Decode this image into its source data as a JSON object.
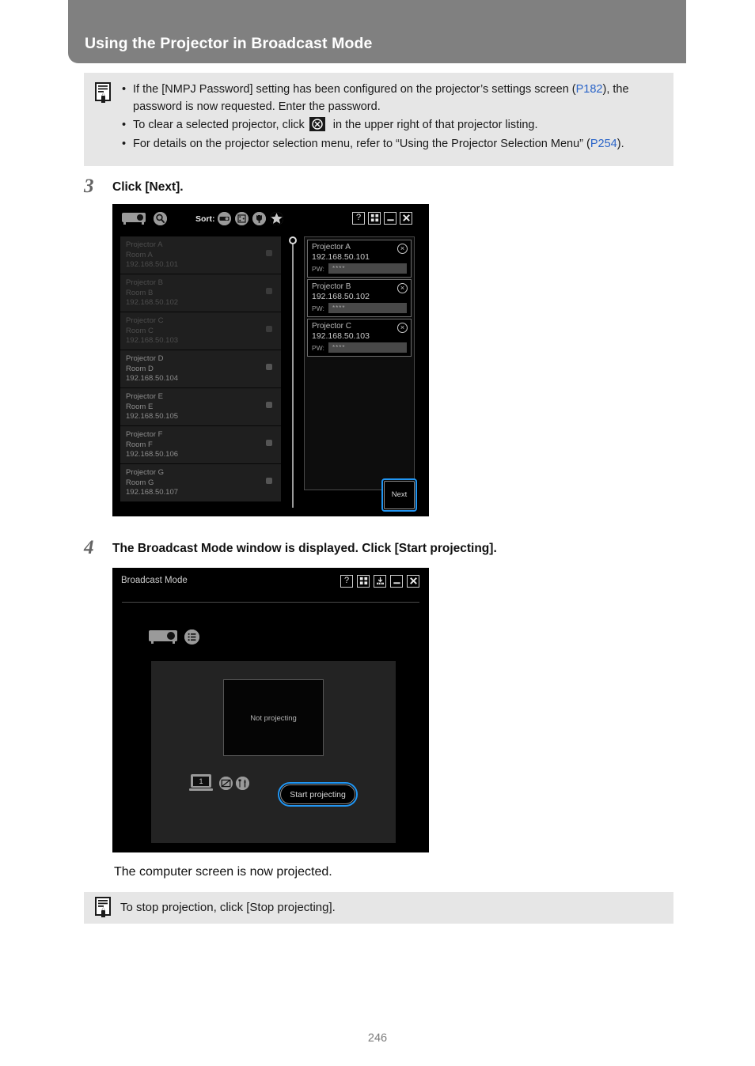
{
  "header": {
    "title": "Using the Projector in Broadcast Mode"
  },
  "note_top": {
    "icon": "note-document-pen-icon",
    "items": [
      {
        "bullet": "•",
        "part1": "If the [NMPJ Password] setting has been configured on the projector’s settings screen (",
        "ref": "P182",
        "part2": "), the password is now requested. Enter the password."
      },
      {
        "bullet": "•",
        "part1": "To clear a selected projector, click",
        "ref": "",
        "part2": "in the upper right of that projector listing."
      },
      {
        "bullet": "•",
        "part1": "For details on the projector selection menu, refer to “Using the Projector Selection Menu” (",
        "ref": "P254",
        "part2": ")."
      }
    ]
  },
  "step3": {
    "number": "3",
    "text": "Click [Next]."
  },
  "step4": {
    "number": "4",
    "text": "The Broadcast Mode window is displayed. Click [Start projecting]."
  },
  "shot1": {
    "toolbar": {
      "projector_icon": "projector-icon",
      "search_icon": "search-icon",
      "sort_label": "Sort:",
      "sort_icons": [
        "sort-by-projector-icon",
        "sort-by-grid-icon",
        "sort-by-power-icon",
        "sort-by-favorite-icon"
      ],
      "window_buttons": [
        {
          "name": "help-button",
          "glyph": "?"
        },
        {
          "name": "grid-layout-button",
          "glyph": "grid"
        },
        {
          "name": "minimize-button",
          "glyph": "minimize"
        },
        {
          "name": "close-button",
          "glyph": "✕"
        }
      ]
    },
    "list": [
      {
        "name": "Projector A",
        "room": "Room A",
        "ip": "192.168.50.101"
      },
      {
        "name": "Projector B",
        "room": "Room B",
        "ip": "192.168.50.102"
      },
      {
        "name": "Projector C",
        "room": "Room C",
        "ip": "192.168.50.103"
      },
      {
        "name": "Projector D",
        "room": "Room D",
        "ip": "192.168.50.104"
      },
      {
        "name": "Projector E",
        "room": "Room E",
        "ip": "192.168.50.105"
      },
      {
        "name": "Projector F",
        "room": "Room F",
        "ip": "192.168.50.106"
      },
      {
        "name": "Projector G",
        "room": "Room G",
        "ip": "192.168.50.107"
      }
    ],
    "selected": [
      {
        "name": "Projector A",
        "ip": "192.168.50.101",
        "pw_label": "PW:",
        "pw_value": "****",
        "clear_glyph": "×"
      },
      {
        "name": "Projector B",
        "ip": "192.168.50.102",
        "pw_label": "PW:",
        "pw_value": "****",
        "clear_glyph": "×"
      },
      {
        "name": "Projector C",
        "ip": "192.168.50.103",
        "pw_label": "PW:",
        "pw_value": "****",
        "clear_glyph": "×"
      }
    ],
    "next_label": "Next",
    "highlight_color": "#2196f3"
  },
  "shot2": {
    "title": "Broadcast Mode",
    "window_buttons": [
      {
        "name": "help-button",
        "glyph": "?"
      },
      {
        "name": "grid-layout-button",
        "glyph": "grid"
      },
      {
        "name": "save-download-button",
        "glyph": "save"
      },
      {
        "name": "minimize-button",
        "glyph": "minimize"
      },
      {
        "name": "close-button",
        "glyph": "✕"
      }
    ],
    "projector_icon": "projector-icon",
    "list_icon": "list-menu-icon",
    "preview_text": "Not projecting",
    "laptop_number": "1",
    "status_icons": [
      "no-display-icon",
      "tools-settings-icon"
    ],
    "start_label": "Start projecting",
    "highlight_color": "#2196f3"
  },
  "after_text": "The computer screen is now projected.",
  "note_bottom": {
    "icon": "note-document-pen-icon",
    "text": "To stop projection, click [Stop projecting]."
  },
  "page_number": "246"
}
